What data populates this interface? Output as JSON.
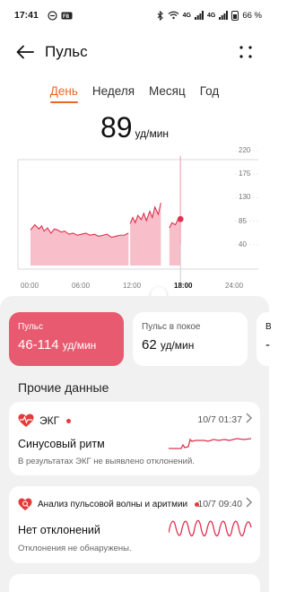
{
  "status_bar": {
    "time": "17:41",
    "left_icons": [
      "dnd-icon",
      "app-icon"
    ],
    "network": "4G",
    "network2": "4G",
    "battery": "66 %"
  },
  "header": {
    "title": "Пульс"
  },
  "tabs": [
    {
      "label": "День",
      "active": true
    },
    {
      "label": "Неделя",
      "active": false
    },
    {
      "label": "Месяц",
      "active": false
    },
    {
      "label": "Год",
      "active": false
    }
  ],
  "current": {
    "value": "89",
    "unit": "уд/мин"
  },
  "chart_data": {
    "type": "area",
    "y_ticks": [
      "220",
      "175",
      "130",
      "85",
      "40"
    ],
    "x_ticks": [
      "00:00",
      "06:00",
      "12:00",
      "18:00",
      "24:00"
    ],
    "highlight_x_tick": "18:00",
    "ylim": [
      0,
      220
    ],
    "xlim": [
      0,
      24
    ],
    "selected_point": {
      "x": 17.6,
      "y": 89
    },
    "segments": [
      {
        "x": [
          0.0,
          0.5,
          1.0,
          1.3,
          1.6,
          2.0,
          2.4,
          2.8,
          3.2,
          3.6,
          4.0,
          4.5,
          5.0,
          5.5,
          6.0,
          6.5,
          7.0,
          7.5,
          8.0,
          8.5,
          9.0,
          9.5,
          10.0,
          10.5,
          11.0,
          11.5
        ],
        "y": [
          68,
          78,
          70,
          76,
          66,
          72,
          62,
          70,
          68,
          64,
          66,
          60,
          62,
          58,
          60,
          62,
          58,
          60,
          56,
          58,
          60,
          54,
          56,
          58,
          58,
          62
        ]
      },
      {
        "x": [
          11.7,
          12.0,
          12.3,
          12.6,
          13.0,
          13.3,
          13.6,
          14.0,
          14.3,
          14.6,
          15.0,
          15.3
        ],
        "y": [
          80,
          92,
          82,
          96,
          88,
          100,
          86,
          104,
          92,
          112,
          98,
          120
        ]
      },
      {
        "x": [
          16.3,
          16.6,
          17.0,
          17.3,
          17.6
        ],
        "y": [
          72,
          82,
          78,
          88,
          89
        ]
      }
    ],
    "spike": {
      "x": 17.6,
      "y_from": 40,
      "y_to": 210
    }
  },
  "summary_cards": [
    {
      "label": "Пульс",
      "value": "46-114",
      "unit": "уд/мин",
      "highlight": true
    },
    {
      "label": "Пульс в покое",
      "value": "62",
      "unit": "уд/мин",
      "highlight": false
    },
    {
      "label": "В",
      "value": "-",
      "unit": "",
      "highlight": false
    }
  ],
  "section": {
    "title": "Прочие данные"
  },
  "ecg_card": {
    "title": "ЭКГ",
    "time": "10/7 01:37",
    "result": "Синусовый ритм",
    "note": "В результатах ЭКГ не выявлено отклонений.",
    "icon": "heart-ecg-icon",
    "accent": "#e53a3a"
  },
  "pwa_card": {
    "title": "Анализ пульсовой волны и аритмии",
    "time": "10/7 09:40",
    "result": "Нет отклонений",
    "note": "Отклонения не обнаружены.",
    "icon": "heart-search-icon",
    "accent": "#e53a3a"
  },
  "colors": {
    "accent_tab": "#e8692a",
    "pulse_card": "#e85a70",
    "chart_line": "#e0314f",
    "chart_fill": "#f7b3c0"
  }
}
